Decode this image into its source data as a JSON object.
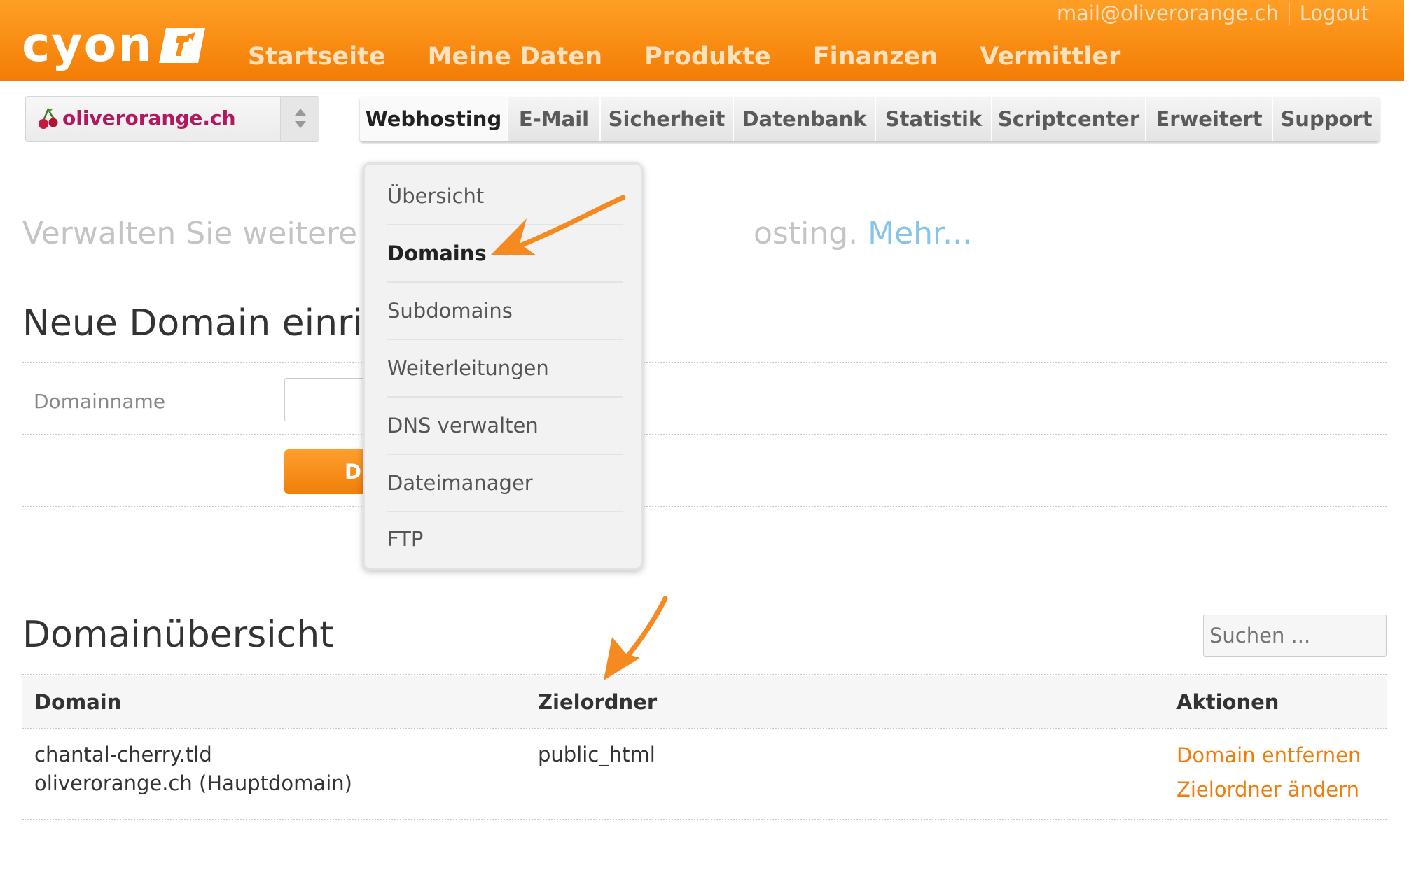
{
  "header": {
    "logo_text": "cyon",
    "nav": [
      "Startseite",
      "Meine Daten",
      "Produkte",
      "Finanzen",
      "Vermittler"
    ],
    "user_email": "mail@oliverorange.ch",
    "logout": "Logout"
  },
  "domain_select": {
    "value": "oliverorange.ch"
  },
  "tabs": [
    "Webhosting",
    "E-Mail",
    "Sicherheit",
    "Datenbank",
    "Statistik",
    "Scriptcenter",
    "Erweitert",
    "Support"
  ],
  "dropdown": {
    "items": [
      "Übersicht",
      "Domains",
      "Subdomains",
      "Weiterleitungen",
      "DNS verwalten",
      "Dateimanager",
      "FTP"
    ],
    "active": "Domains"
  },
  "intro": {
    "text_a": "Verwalten Sie weitere D",
    "text_b": "osting.",
    "more_link": "Mehr..."
  },
  "new_domain": {
    "title": "Neue Domain einrich",
    "label": "Domainname",
    "input_value": "",
    "button_label": "D"
  },
  "overview": {
    "title": "Domainübersicht",
    "search_placeholder": "Suchen ...",
    "columns": [
      "Domain",
      "Zielordner",
      "Aktionen"
    ],
    "rows": [
      {
        "domains": [
          "chantal-cherry.tld",
          "oliverorange.ch (Hauptdomain)"
        ],
        "folder": "public_html",
        "actions": [
          "Domain entfernen",
          "Zielordner ändern"
        ]
      }
    ]
  },
  "colors": {
    "brand_orange": "#f98c13",
    "link_orange": "#f27c0a",
    "domain_magenta": "#b2185f",
    "link_blue": "#86c4e8"
  }
}
